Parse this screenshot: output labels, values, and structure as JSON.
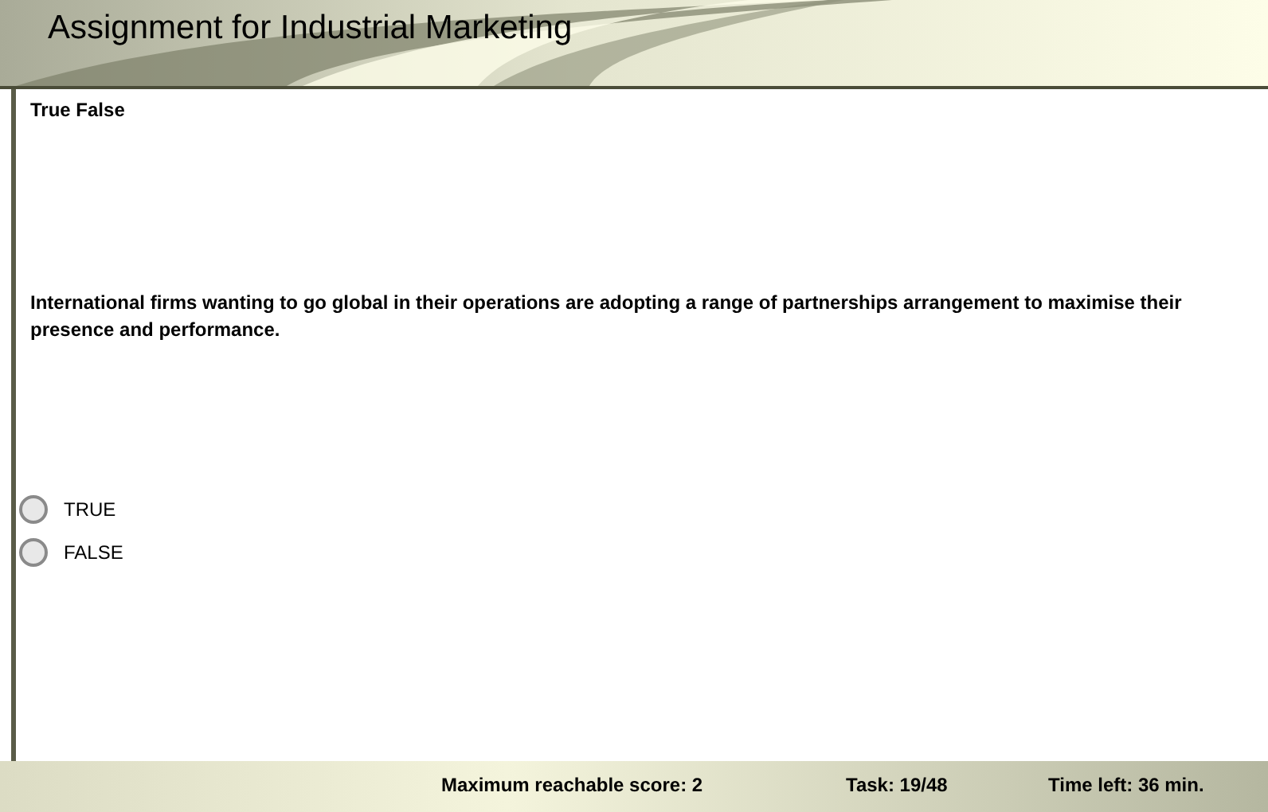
{
  "window": {
    "title": "Assignment for Industrial Marketing"
  },
  "question": {
    "type_label": "True False",
    "text": "International firms wanting to go global in their operations are adopting a range of partnerships arrangement to maximise their presence and performance.",
    "options": [
      {
        "label": "TRUE",
        "selected": false
      },
      {
        "label": "FALSE",
        "selected": false
      }
    ]
  },
  "status_bar": {
    "max_score": "Maximum reachable score: 2",
    "task": "Task: 19/48",
    "time_left": "Time left: 36 min."
  }
}
